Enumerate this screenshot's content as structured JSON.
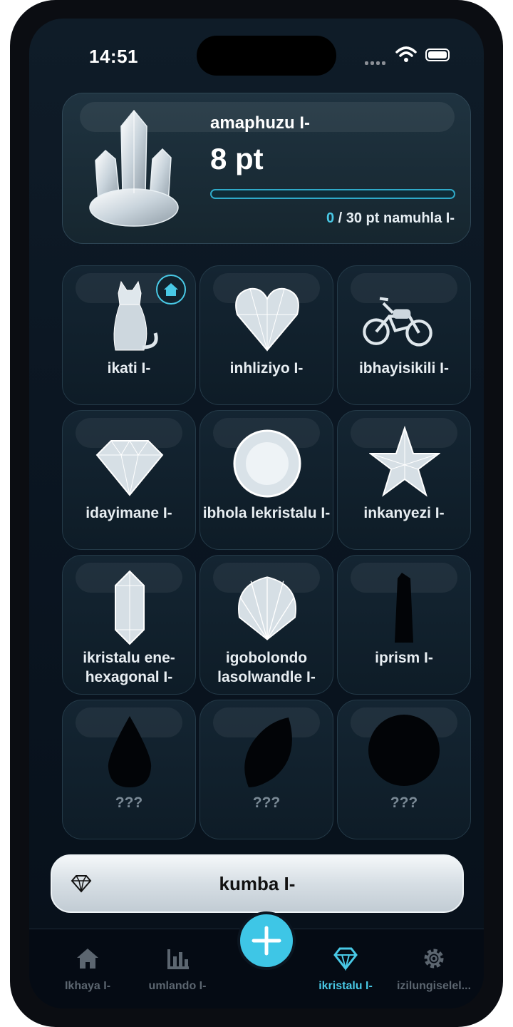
{
  "status_bar": {
    "time": "14:51"
  },
  "summary": {
    "title": "amaphuzu I-",
    "points": "8 pt",
    "progress_current": "0",
    "progress_rest": " / 30 pt namuhla I-",
    "progress_fraction": 0
  },
  "crystals": [
    {
      "label": "ikati I-",
      "icon": "cat-icon",
      "unlocked": true,
      "home": true
    },
    {
      "label": "inhliziyo I-",
      "icon": "heart-icon",
      "unlocked": true
    },
    {
      "label": "ibhayisikili I-",
      "icon": "motorcycle-icon",
      "unlocked": true
    },
    {
      "label": "idayimane I-",
      "icon": "diamond-icon",
      "unlocked": true
    },
    {
      "label": "ibhola lekristalu I-",
      "icon": "crystal-ball-icon",
      "unlocked": true
    },
    {
      "label": "inkanyezi I-",
      "icon": "star-icon",
      "unlocked": true
    },
    {
      "label": "ikristalu ene-hexagonal I-",
      "icon": "hexagonal-crystal-icon",
      "unlocked": true
    },
    {
      "label": "igobolondo lasolwandle I-",
      "icon": "seashell-icon",
      "unlocked": true
    },
    {
      "label": "iprism I-",
      "icon": "prism-icon",
      "unlocked": false
    },
    {
      "label": "???",
      "icon": "drop-icon",
      "unlocked": false
    },
    {
      "label": "???",
      "icon": "leaf-icon",
      "unlocked": false
    },
    {
      "label": "???",
      "icon": "flower-icon",
      "unlocked": false
    }
  ],
  "count_button": {
    "label": "kumba I-"
  },
  "tabs": [
    {
      "label": "Ikhaya I-",
      "icon": "home-icon"
    },
    {
      "label": "umlando I-",
      "icon": "chart-icon"
    },
    {
      "label": "ikristalu I-",
      "icon": "gem-icon",
      "active": true
    },
    {
      "label": "izilungiselel...",
      "icon": "gear-icon"
    }
  ],
  "colors": {
    "accent": "#49c9e6",
    "background": "#0b1622",
    "card": "#1f3340"
  }
}
